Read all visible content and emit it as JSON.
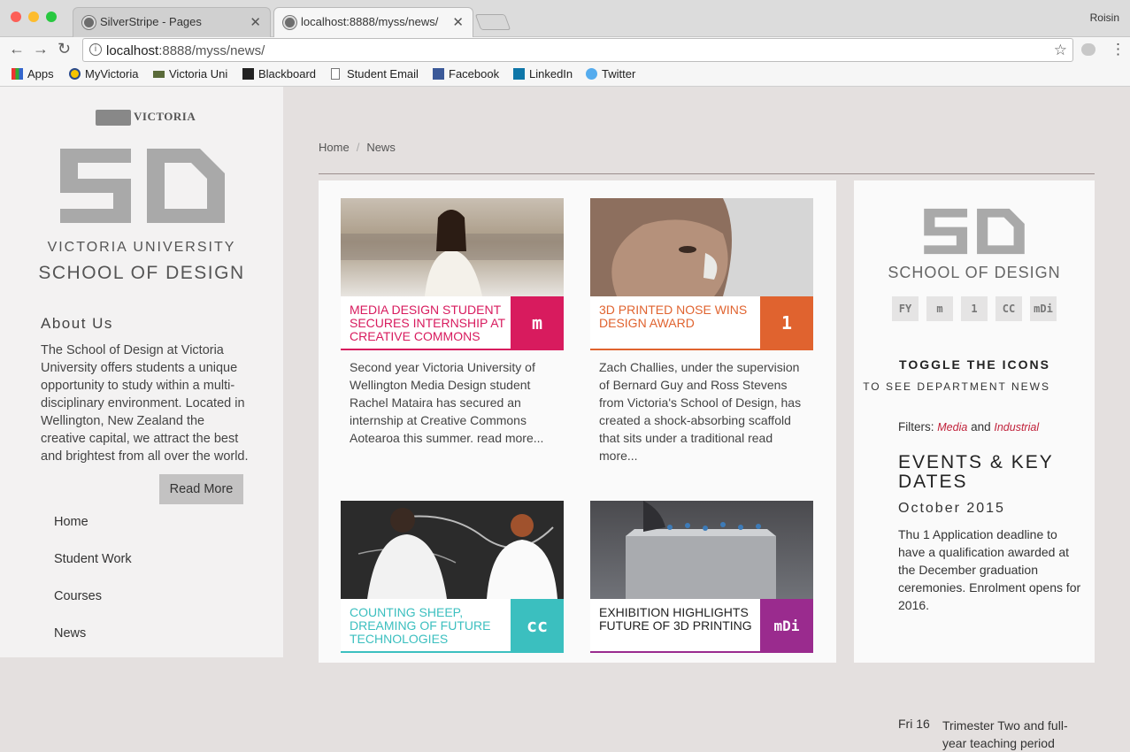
{
  "browser": {
    "tabs": [
      {
        "label": "SilverStripe - Pages",
        "active": false
      },
      {
        "label": "localhost:8888/myss/news/",
        "active": true
      }
    ],
    "user": "Roisin",
    "url_host": "localhost",
    "url_path": ":8888/myss/news/",
    "bookmarks": [
      {
        "label": "Apps",
        "icon": "apps-grid-icon"
      },
      {
        "label": "MyVictoria",
        "icon": "myvictoria-icon"
      },
      {
        "label": "Victoria Uni",
        "icon": "victoria-uni-icon"
      },
      {
        "label": "Blackboard",
        "icon": "blackboard-icon"
      },
      {
        "label": "Student Email",
        "icon": "page-icon"
      },
      {
        "label": "Facebook",
        "icon": "facebook-icon"
      },
      {
        "label": "LinkedIn",
        "icon": "linkedin-icon"
      },
      {
        "label": "Twitter",
        "icon": "twitter-icon"
      }
    ]
  },
  "sidebar": {
    "vic_logo": "VICTORIA",
    "logo_text": "5D",
    "university": "VICTORIA UNIVERSITY",
    "school": "SCHOOL OF DESIGN",
    "about_title": "About Us",
    "about_text": "The School of Design at Victoria University offers students a unique opportunity to study within a multi-disciplinary environment. Located in Wellington, New Zealand the creative capital, we attract the best and brightest from all over the world.",
    "read_more": "Read More",
    "nav": [
      "Home",
      "Student Work",
      "Courses",
      "News"
    ]
  },
  "breadcrumb": {
    "home": "Home",
    "sep": "/",
    "current": "News"
  },
  "articles": [
    {
      "title": "MEDIA DESIGN STUDENT SECURES INTERNSHIP AT CREATIVE COMMONS",
      "badge": "m",
      "color": "#d81b5e",
      "body": "Second year Victoria University of Wellington Media Design student Rachel Mataira has secured an internship at Creative Commons Aotearoa this summer.",
      "more": "read more..."
    },
    {
      "title": "3D PRINTED NOSE WINS DESIGN AWARD",
      "badge": "1",
      "color": "#e0632f",
      "body": "Zach Challies, under the supervision of Bernard Guy and Ross Stevens from Victoria's School of Design, has created a shock-absorbing scaffold that sits under a traditional",
      "more": "read more..."
    },
    {
      "title": "COUNTING SHEEP, DREAMING OF FUTURE TECHNOLOGIES",
      "badge": "cc",
      "color": "#3bbfbf"
    },
    {
      "title": "EXHIBITION HIGHLIGHTS FUTURE OF 3D PRINTING",
      "badge": "mDi",
      "color": "#9a2b8e"
    }
  ],
  "right": {
    "logo_text": "5D",
    "school": "SCHOOL OF DESIGN",
    "dept_icons": [
      "FY",
      "m",
      "1",
      "CC",
      "mDi"
    ],
    "toggle_title": "TOGGLE THE ICONS",
    "toggle_sub": "TO SEE DEPARTMENT NEWS",
    "filters_label": "Filters:",
    "filter_media": "Media",
    "filter_and": "and",
    "filter_industrial": "Industrial",
    "events_title": "EVENTS & KEY DATES",
    "month": "October 2015",
    "event1": "Thu 1 Application deadline to have a qualification awarded at the December graduation ceremonies. Enrolment opens for 2016.",
    "event2_date": "Fri 16",
    "event2_text": "Trimester Two and full-year teaching period"
  }
}
